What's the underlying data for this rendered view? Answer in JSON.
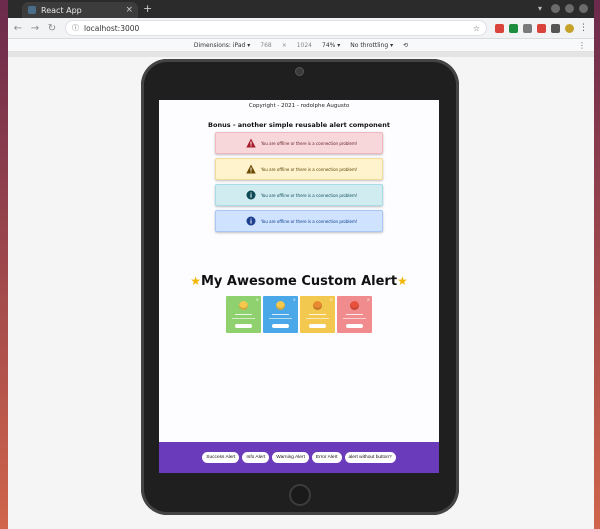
{
  "browser": {
    "tab_title": "React App",
    "tab_close": "×",
    "new_tab": "+",
    "url": "localhost:3000",
    "extension_colors": [
      "#d9433b",
      "#1e8e3e",
      "#7a7a7a",
      "#d9433b",
      "#555555",
      "#c7a22b"
    ]
  },
  "devtools": {
    "dimensions_label": "Dimensions: iPad ▾",
    "width": "768",
    "times": "×",
    "height": "1024",
    "zoom": "74% ▾",
    "throttling": "No throttling ▾"
  },
  "app": {
    "copyright": "Copyright - 2021 - rodolphe Augusto",
    "bonus_title": "Bonus - another simple reusable alert component",
    "alerts": [
      {
        "text": "You are offline or there is a connection problem!",
        "kind": "error",
        "icon": "warning-icon",
        "color": "#a61b29"
      },
      {
        "text": "You are offline or there is a connection problem!",
        "kind": "warning",
        "icon": "warning-icon",
        "color": "#6b4a00"
      },
      {
        "text": "You are offline or there is a connection problem!",
        "kind": "info",
        "icon": "info-icon",
        "color": "#0c4a55"
      },
      {
        "text": "You are offline or there is a connection problem!",
        "kind": "primary",
        "icon": "info-icon",
        "color": "#1c3f8f"
      }
    ],
    "heading": "My Awesome Custom Alert",
    "cards": [
      {
        "color": "#8fd16e"
      },
      {
        "color": "#4aa7e8"
      },
      {
        "color": "#f3c84f"
      },
      {
        "color": "#f08c8e"
      }
    ],
    "buttons": [
      "Success Alert",
      "Info Alert",
      "Warning Alert",
      "Error Alert",
      "alert without button?"
    ]
  },
  "colors": {
    "bottom_bar": "#6a3cbc",
    "star": "#f2b705"
  }
}
